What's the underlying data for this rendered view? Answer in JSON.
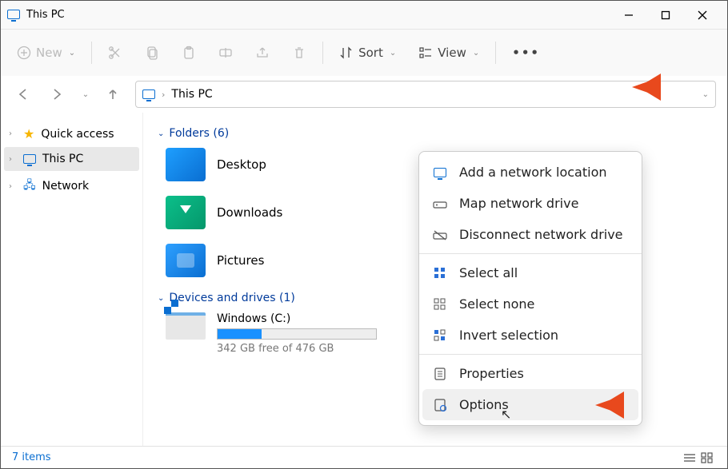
{
  "title": "This PC",
  "toolbar": {
    "new": "New",
    "sort": "Sort",
    "view": "View"
  },
  "address": {
    "location": "This PC"
  },
  "sidebar": {
    "items": [
      {
        "label": "Quick access",
        "icon": "star"
      },
      {
        "label": "This PC",
        "icon": "monitor",
        "selected": true
      },
      {
        "label": "Network",
        "icon": "network"
      }
    ]
  },
  "groups": {
    "folders_header": "Folders (6)",
    "folders": [
      {
        "label": "Desktop"
      },
      {
        "label": "Downloads"
      },
      {
        "label": "Pictures"
      }
    ],
    "drives_header": "Devices and drives (1)",
    "drive": {
      "label": "Windows (C:)",
      "sub": "342 GB free of 476 GB",
      "used_pct": 28
    }
  },
  "menu": {
    "items": [
      "Add a network location",
      "Map network drive",
      "Disconnect network drive",
      "Select all",
      "Select none",
      "Invert selection",
      "Properties",
      "Options"
    ]
  },
  "status": {
    "text": "7 items"
  }
}
